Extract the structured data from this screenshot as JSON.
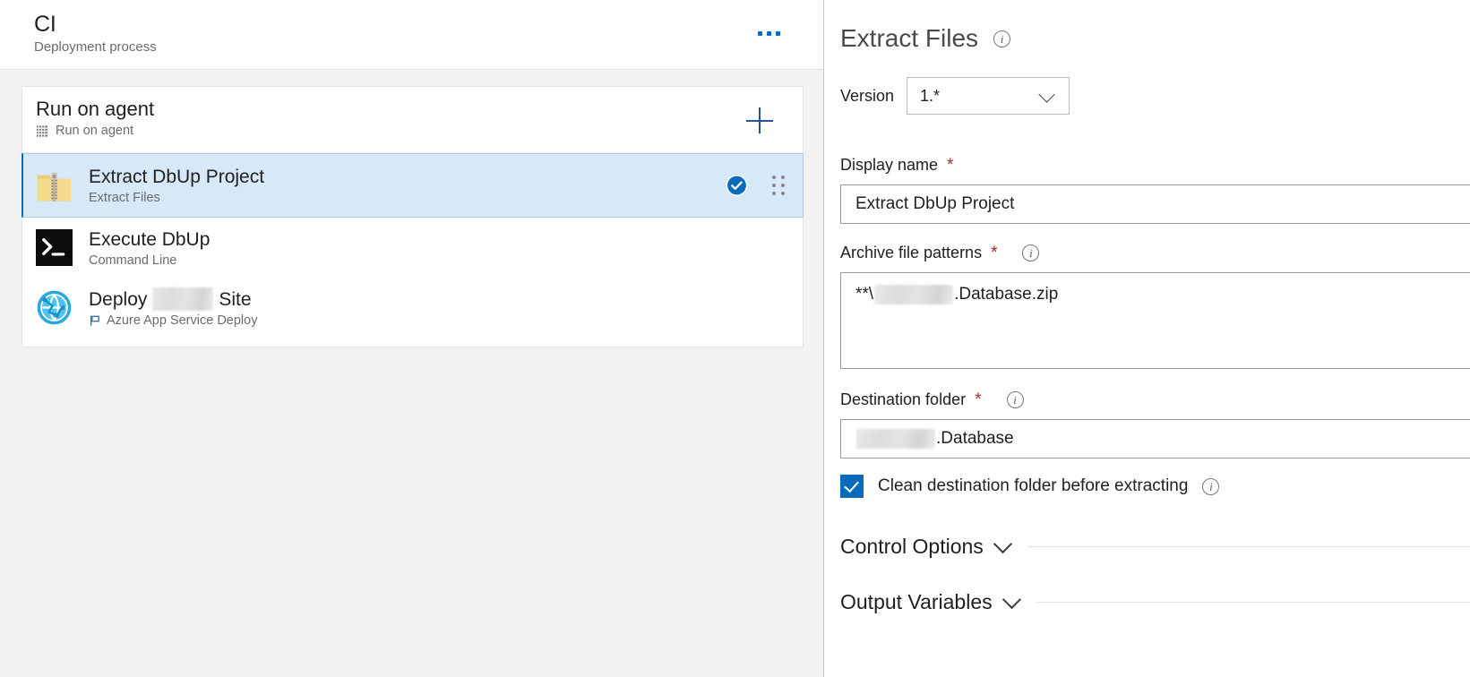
{
  "process": {
    "title": "CI",
    "subtitle": "Deployment process",
    "more_menu_label": "...",
    "more_menu_icon": "ellipsis-horizontal-icon"
  },
  "phase": {
    "name": "Run on agent",
    "subtitle": "Run on agent",
    "subtitle_icon": "agent-server-icon",
    "add_button_icon": "plus-icon"
  },
  "tasks": [
    {
      "name": "Extract DbUp Project",
      "subtitle": "Extract Files",
      "icon": "zip-folder-icon",
      "selected": true,
      "status_icon": "check-circle-filled-icon",
      "drag_icon": "drag-dots-icon",
      "redacted": false
    },
    {
      "name": "Execute DbUp",
      "subtitle": "Command Line",
      "icon": "command-prompt-icon",
      "selected": false,
      "redacted": false
    },
    {
      "name_before": "Deploy",
      "name_after": "Site",
      "subtitle": "Azure App Service Deploy",
      "subtitle_icon": "flag-outline-icon",
      "icon": "azure-globe-icon",
      "selected": false,
      "redacted": true
    }
  ],
  "details": {
    "panel_title": "Extract Files",
    "panel_info_icon": "info-circle-icon",
    "version": {
      "label": "Version",
      "value": "1.*",
      "chevron_icon": "chevron-down-icon"
    },
    "display_name": {
      "label": "Display name",
      "required_marker": "*",
      "value": "Extract DbUp Project"
    },
    "archive_patterns": {
      "label": "Archive file patterns",
      "required_marker": "*",
      "info_icon": "info-circle-icon",
      "value_prefix": "**\\",
      "value_suffix": ".Database.zip"
    },
    "destination_folder": {
      "label": "Destination folder",
      "required_marker": "*",
      "info_icon": "info-circle-icon",
      "value_suffix": ".Database"
    },
    "clean_destination": {
      "label": "Clean destination folder before extracting",
      "checked": true,
      "check_icon": "checkmark-icon",
      "info_icon": "info-circle-icon"
    },
    "sections": [
      {
        "title": "Control Options",
        "chevron_icon": "chevron-down-icon",
        "expanded": false
      },
      {
        "title": "Output Variables",
        "chevron_icon": "chevron-down-icon",
        "expanded": false
      }
    ]
  },
  "colors": {
    "accent_blue": "#0a6bbd",
    "selected_row_bg": "#d7e8f8",
    "selected_row_border": "#a9cdea",
    "pane_bg": "#f3f2f1",
    "required_red": "#a4262c",
    "muted_text": "#6b6b6b",
    "zip_yellow": "#f2d06b",
    "cmd_black": "#0c0c0c",
    "globe_blue": "#28a8e0"
  }
}
